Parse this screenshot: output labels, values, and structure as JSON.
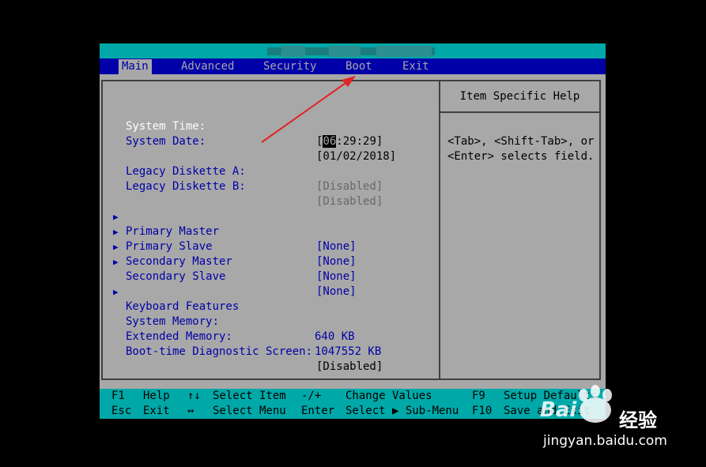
{
  "menu": {
    "tabs": [
      "Main",
      "Advanced",
      "Security",
      "Boot",
      "Exit"
    ],
    "active": "Main"
  },
  "main": {
    "system_time": {
      "label": "System Time:",
      "value_cursor": "06",
      "value_rest": ":29:29]",
      "bracket_open": "["
    },
    "system_date": {
      "label": "System Date:",
      "value": "[01/02/2018]"
    },
    "legacy_a": {
      "label": "Legacy Diskette A:",
      "value": "[Disabled]"
    },
    "legacy_b": {
      "label": "Legacy Diskette B:",
      "value": "[Disabled]"
    },
    "primary_master": {
      "label": "Primary Master",
      "value": "[None]"
    },
    "primary_slave": {
      "label": "Primary Slave",
      "value": "[None]"
    },
    "secondary_master": {
      "label": "Secondary Master",
      "value": "[None]"
    },
    "secondary_slave": {
      "label": "Secondary Slave",
      "value": "[None]"
    },
    "keyboard_features": {
      "label": "Keyboard Features"
    },
    "system_memory": {
      "label": "System Memory:",
      "value": "640 KB"
    },
    "extended_memory": {
      "label": "Extended Memory:",
      "value": "1047552 KB"
    },
    "boot_diag": {
      "label": "Boot-time Diagnostic Screen:",
      "value": "[Disabled]"
    },
    "submenu_arrow": "▶"
  },
  "help": {
    "title": "Item Specific Help",
    "text": "<Tab>, <Shift-Tab>, or\n<Enter> selects field."
  },
  "footer": {
    "f1_key": "F1",
    "f1_label": "Help",
    "updown_key": "↑↓",
    "updown_label": "Select Item",
    "minusplus_key": "-/+",
    "minusplus_label": "Change Values",
    "f9_key": "F9",
    "f9_label": "Setup Defaults",
    "esc_key": "Esc",
    "esc_label": "Exit",
    "leftright_key": "↔",
    "leftright_label": "Select Menu",
    "enter_key": "Enter",
    "enter_label": "Select ▶ Sub-Menu",
    "f10_key": "F10",
    "f10_label": "Save and Exit"
  },
  "watermark": {
    "brand": "Bai",
    "brand_cn": "经验",
    "url": "jingyan.baidu.com"
  },
  "colors": {
    "bios_bg": "#a8a8a8",
    "menubar": "#0000a8",
    "titlebar": "#00a8a8",
    "label_blue": "#0000a8",
    "annotation_red": "#e02424"
  }
}
